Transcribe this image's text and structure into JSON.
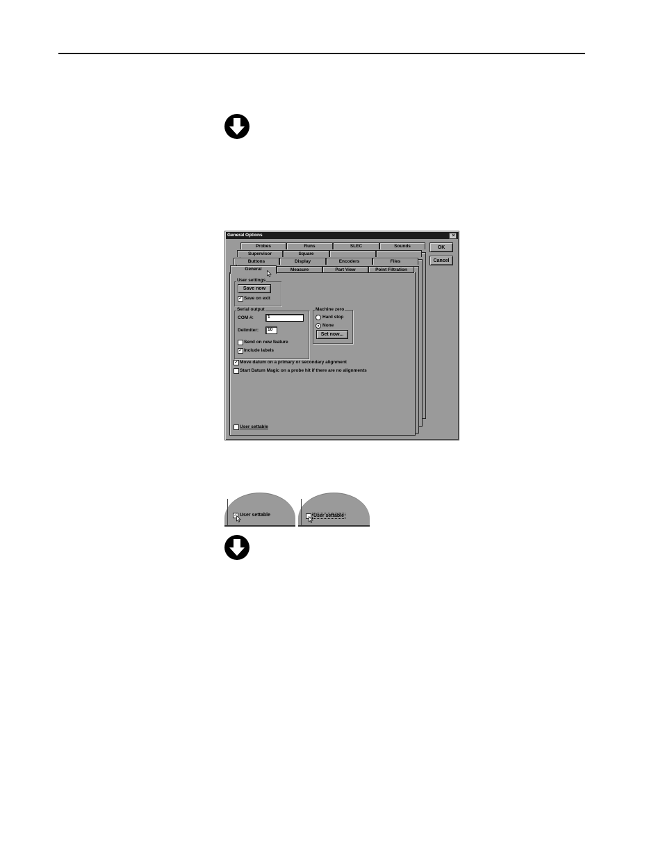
{
  "dialog": {
    "title": "General Options",
    "close_glyph": "×",
    "buttons": {
      "ok": "OK",
      "cancel": "Cancel"
    },
    "tab_rows": [
      [
        "Probes",
        "Runs",
        "SLEC",
        "Sounds"
      ],
      [
        "Supervisor",
        "Square"
      ],
      [
        "Buttons",
        "Display",
        "Encoders",
        "Files"
      ],
      [
        "General",
        "Measure",
        "Part View",
        "Point Filtration"
      ]
    ],
    "user_settings": {
      "label": "User settings",
      "save_now": "Save now",
      "save_on_exit": "Save on exit",
      "save_on_exit_checked": true
    },
    "serial_output": {
      "label": "Serial output",
      "com_label": "COM #:",
      "com_value": "1",
      "delimiter_label": "Delimiter:",
      "delimiter_value": "10",
      "send_on_new_feature": "Send on new feature",
      "send_on_new_feature_checked": false,
      "include_labels": "Include labels",
      "include_labels_checked": true
    },
    "machine_zero": {
      "label": "Machine zero",
      "hard_stop": "Hard stop",
      "none": "None",
      "selected": "None",
      "set_now": "Set now..."
    },
    "move_datum": "Move datum on a primary or secondary alignment",
    "move_datum_checked": true,
    "start_datum_magic": "Start Datum Magic on a probe hit if there are no alignments",
    "start_datum_magic_checked": false,
    "user_settable": "User settable",
    "user_settable_checked": false
  },
  "zoom": {
    "left": {
      "label": "User settable",
      "checked": true,
      "check_glyph": "✓"
    },
    "right": {
      "label": "User settable",
      "checked": false
    }
  },
  "icons": {
    "top_arrow": "down-arrow-icon",
    "bottom_arrow": "down-arrow-icon",
    "cursor": "mouse-pointer-icon"
  },
  "check_glyph": "✓"
}
